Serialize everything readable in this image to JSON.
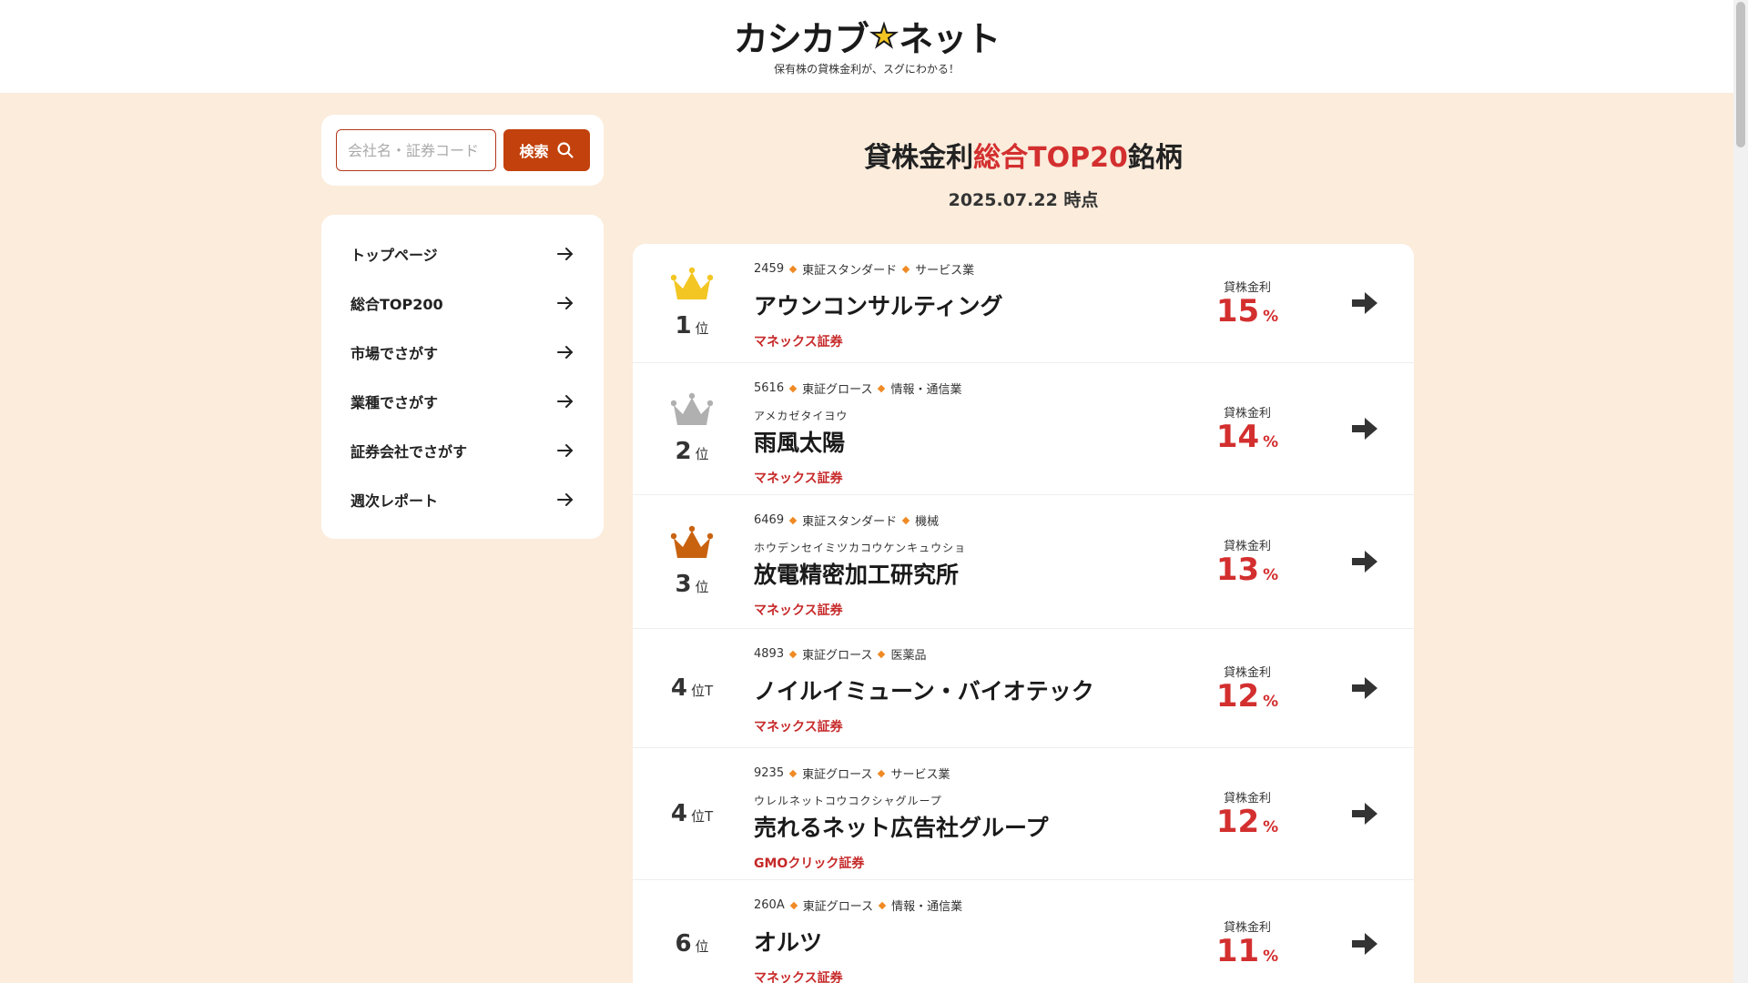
{
  "header": {
    "logo_part1": "カシカブ",
    "logo_part2": "ネット",
    "tagline": "保有株の貸株金利が、スグにわかる！"
  },
  "search": {
    "placeholder": "会社名・証券コード",
    "button_label": "検索"
  },
  "nav": [
    {
      "label": "トップページ"
    },
    {
      "label": "総合TOP200"
    },
    {
      "label": "市場でさがす"
    },
    {
      "label": "業種でさがす"
    },
    {
      "label": "証券会社でさがす"
    },
    {
      "label": "週次レポート"
    }
  ],
  "main": {
    "title_pre": "貸株金利",
    "title_accent": "総合TOP20",
    "title_post": "銘柄",
    "date": "2025.07.22 時点"
  },
  "colors": {
    "accent": "#d32f2f",
    "button": "#c2410c",
    "background": "#fbecdc",
    "crown_gold": "#f3c623",
    "crown_silver": "#b0b0b0",
    "crown_bronze": "#c9620f"
  },
  "rows": [
    {
      "rank": "1",
      "rank_unit": "位",
      "crown": "gold",
      "code": "2459",
      "market": "東証スタンダード",
      "industry": "サービス業",
      "kana": "",
      "name": "アウンコンサルティング",
      "broker": "マネックス証券",
      "rate_label": "貸株金利",
      "rate": "15",
      "pct": "%"
    },
    {
      "rank": "2",
      "rank_unit": "位",
      "crown": "silver",
      "code": "5616",
      "market": "東証グロース",
      "industry": "情報・通信業",
      "kana": "アメカゼタイヨウ",
      "name": "雨風太陽",
      "broker": "マネックス証券",
      "rate_label": "貸株金利",
      "rate": "14",
      "pct": "%"
    },
    {
      "rank": "3",
      "rank_unit": "位",
      "crown": "bronze",
      "code": "6469",
      "market": "東証スタンダード",
      "industry": "機械",
      "kana": "ホウデンセイミツカコウケンキュウショ",
      "name": "放電精密加工研究所",
      "broker": "マネックス証券",
      "rate_label": "貸株金利",
      "rate": "13",
      "pct": "%"
    },
    {
      "rank": "4",
      "rank_unit": "位T",
      "crown": "",
      "code": "4893",
      "market": "東証グロース",
      "industry": "医薬品",
      "kana": "",
      "name": "ノイルイミューン・バイオテック",
      "broker": "マネックス証券",
      "rate_label": "貸株金利",
      "rate": "12",
      "pct": "%"
    },
    {
      "rank": "4",
      "rank_unit": "位T",
      "crown": "",
      "code": "9235",
      "market": "東証グロース",
      "industry": "サービス業",
      "kana": "ウレルネットコウコクシャグループ",
      "name": "売れるネット広告社グループ",
      "broker": "GMOクリック証券",
      "rate_label": "貸株金利",
      "rate": "12",
      "pct": "%"
    },
    {
      "rank": "6",
      "rank_unit": "位",
      "crown": "",
      "code": "260A",
      "market": "東証グロース",
      "industry": "情報・通信業",
      "kana": "",
      "name": "オルツ",
      "broker": "マネックス証券",
      "rate_label": "貸株金利",
      "rate": "11",
      "pct": "%"
    }
  ]
}
